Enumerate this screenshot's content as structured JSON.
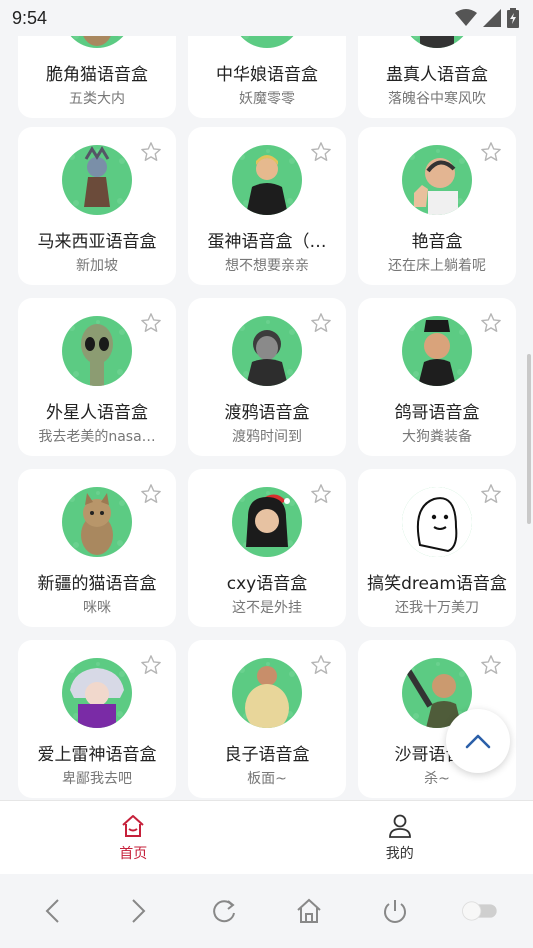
{
  "status_bar": {
    "time": "9:54"
  },
  "cards": [
    {
      "title": "脆角猫语音盒",
      "subtitle": "五类大内",
      "icon": "cat-avatar"
    },
    {
      "title": "中华娘语音盒",
      "subtitle": "妖魔零零",
      "icon": "girl-avatar"
    },
    {
      "title": "蛊真人语音盒",
      "subtitle": "落魄谷中寒风吹",
      "icon": "man-avatar"
    },
    {
      "title": "马来西亚语音盒",
      "subtitle": "新加坡",
      "icon": "warrior-avatar"
    },
    {
      "title": "蛋神语音盒（…",
      "subtitle": "想不想要亲亲",
      "icon": "yellow-hair-man-avatar"
    },
    {
      "title": "艳音盒",
      "subtitle": "还在床上躺着呢",
      "icon": "thumbs-up-man-avatar"
    },
    {
      "title": "外星人语音盒",
      "subtitle": "我去老美的nasa…",
      "icon": "alien-avatar"
    },
    {
      "title": "渡鸦语音盒",
      "subtitle": "渡鸦时间到",
      "icon": "masked-man-avatar"
    },
    {
      "title": "鸽哥语音盒",
      "subtitle": "大狗粪装备",
      "icon": "hat-man-avatar"
    },
    {
      "title": "新疆的猫语音盒",
      "subtitle": "咪咪",
      "icon": "cat-avatar"
    },
    {
      "title": "cxy语音盒",
      "subtitle": "这不是外挂",
      "icon": "santa-hat-avatar"
    },
    {
      "title": "搞笑dream语音盒",
      "subtitle": "还我十万美刀",
      "icon": "blob-face-avatar"
    },
    {
      "title": "爱上雷神语音盒",
      "subtitle": "卑鄙我去吧",
      "icon": "anime-avatar"
    },
    {
      "title": "良子语音盒",
      "subtitle": "板面~",
      "icon": "big-man-avatar"
    },
    {
      "title": "沙哥语音盒",
      "subtitle": "杀~",
      "icon": "knife-man-avatar"
    }
  ],
  "tabbar": {
    "home_label": "首页",
    "mine_label": "我的"
  },
  "colors": {
    "accent": "#c6203a",
    "avatar_bg": "#5ccb83"
  }
}
